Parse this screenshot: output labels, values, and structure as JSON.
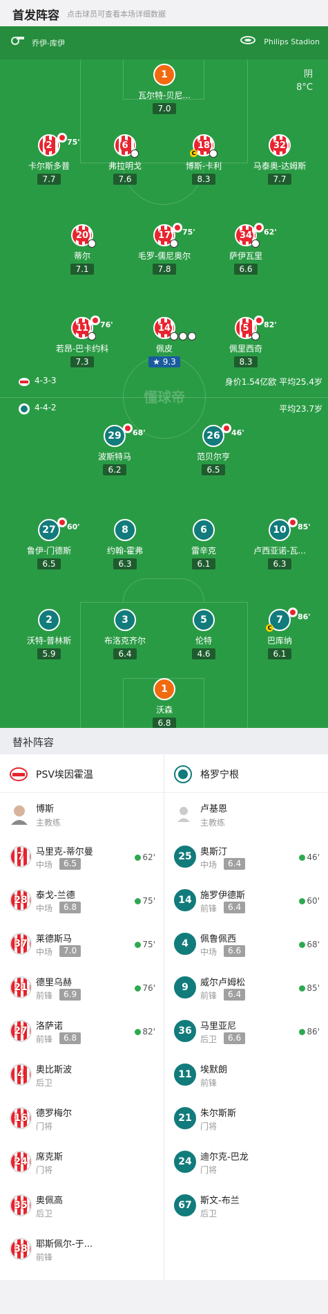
{
  "header": {
    "title": "首发阵容",
    "subtitle": "点击球员可查看本场详细数据"
  },
  "topbar": {
    "referee": "乔伊-库伊",
    "stadium": "Philips Stadion",
    "weather": "阴",
    "temperature": "8°C"
  },
  "watermark": "懂球帝",
  "home": {
    "formation": "4-3-3",
    "value": "身价1.54亿欧",
    "age": "平均25.4岁",
    "players": [
      {
        "num": "1",
        "name": "瓦尔特-贝尼...",
        "rating": "7.0"
      },
      {
        "num": "2",
        "name": "卡尔斯多普",
        "rating": "7.7",
        "sub_min": "75'"
      },
      {
        "num": "6",
        "name": "弗拉明戈",
        "rating": "7.6"
      },
      {
        "num": "18",
        "name": "博斯-卡利",
        "rating": "8.3"
      },
      {
        "num": "32",
        "name": "马泰奥-达姆斯",
        "rating": "7.7"
      },
      {
        "num": "20",
        "name": "蒂尔",
        "rating": "7.1"
      },
      {
        "num": "17",
        "name": "毛罗-儒尼奥尔",
        "rating": "7.8",
        "sub_min": "75'"
      },
      {
        "num": "34",
        "name": "萨伊瓦里",
        "rating": "6.6",
        "sub_min": "62'"
      },
      {
        "num": "11",
        "name": "若昂-巴卡约科",
        "rating": "7.3",
        "sub_min": "76'"
      },
      {
        "num": "14",
        "name": "佩皮",
        "rating": "9.3"
      },
      {
        "num": "5",
        "name": "佩里西奇",
        "rating": "8.3",
        "sub_min": "82'"
      }
    ]
  },
  "away": {
    "formation": "4-4-2",
    "age": "平均23.7岁",
    "players": [
      {
        "num": "29",
        "name": "波斯特马",
        "rating": "6.2",
        "sub_min": "68'"
      },
      {
        "num": "26",
        "name": "范贝尔亨",
        "rating": "6.5",
        "sub_min": "46'"
      },
      {
        "num": "27",
        "name": "鲁伊-门德斯",
        "rating": "6.5",
        "sub_min": "60'"
      },
      {
        "num": "8",
        "name": "约翰-霍弗",
        "rating": "6.3"
      },
      {
        "num": "6",
        "name": "雷辛克",
        "rating": "6.1"
      },
      {
        "num": "10",
        "name": "卢西亚诺-瓦...",
        "rating": "6.3",
        "sub_min": "85'"
      },
      {
        "num": "2",
        "name": "沃特-普林斯",
        "rating": "5.9"
      },
      {
        "num": "3",
        "name": "布洛克齐尔",
        "rating": "6.4"
      },
      {
        "num": "5",
        "name": "伦特",
        "rating": "4.6"
      },
      {
        "num": "7",
        "name": "巴库纳",
        "rating": "6.1",
        "sub_min": "86'"
      },
      {
        "num": "1",
        "name": "沃森",
        "rating": "6.8"
      }
    ]
  },
  "subs": {
    "title": "替补阵容",
    "home_team": "PSV埃因霍温",
    "away_team": "格罗宁根",
    "home_coach": {
      "name": "博斯",
      "role": "主教练"
    },
    "away_coach": {
      "name": "卢基恩",
      "role": "主教练"
    },
    "home": [
      {
        "num": "7",
        "name": "马里克-蒂尔曼",
        "pos": "中场",
        "rating": "6.5",
        "min": "62'"
      },
      {
        "num": "28",
        "name": "泰戈-兰德",
        "pos": "中场",
        "rating": "6.8",
        "min": "75'"
      },
      {
        "num": "37",
        "name": "莱德斯马",
        "pos": "中场",
        "rating": "7.0",
        "min": "75'"
      },
      {
        "num": "21",
        "name": "德里乌赫",
        "pos": "前锋",
        "rating": "6.9",
        "min": "76'"
      },
      {
        "num": "27",
        "name": "洛萨诺",
        "pos": "前锋",
        "rating": "6.8",
        "min": "82'"
      },
      {
        "num": "4",
        "name": "奥比斯波",
        "pos": "后卫"
      },
      {
        "num": "16",
        "name": "德罗梅尔",
        "pos": "门将"
      },
      {
        "num": "24",
        "name": "席克斯",
        "pos": "门将"
      },
      {
        "num": "35",
        "name": "奥佩高",
        "pos": "后卫"
      },
      {
        "num": "38",
        "name": "耶斯佩尔-于...",
        "pos": "前锋"
      }
    ],
    "away": [
      {
        "num": "25",
        "name": "奥斯汀",
        "pos": "中场",
        "rating": "6.4",
        "min": "46'"
      },
      {
        "num": "14",
        "name": "施罗伊德斯",
        "pos": "前锋",
        "rating": "6.4",
        "min": "60'"
      },
      {
        "num": "4",
        "name": "佩鲁佩西",
        "pos": "中场",
        "rating": "6.6",
        "min": "68'"
      },
      {
        "num": "9",
        "name": "威尔卢姆松",
        "pos": "前锋",
        "rating": "6.4",
        "min": "85'"
      },
      {
        "num": "36",
        "name": "马里亚尼",
        "pos": "后卫",
        "rating": "6.6",
        "min": "86'"
      },
      {
        "num": "11",
        "name": "埃默朗",
        "pos": "前锋"
      },
      {
        "num": "21",
        "name": "朱尔斯斯",
        "pos": "门将"
      },
      {
        "num": "24",
        "name": "迪尔克-巴龙",
        "pos": "门将"
      },
      {
        "num": "67",
        "name": "斯文-布兰",
        "pos": "后卫"
      }
    ]
  }
}
